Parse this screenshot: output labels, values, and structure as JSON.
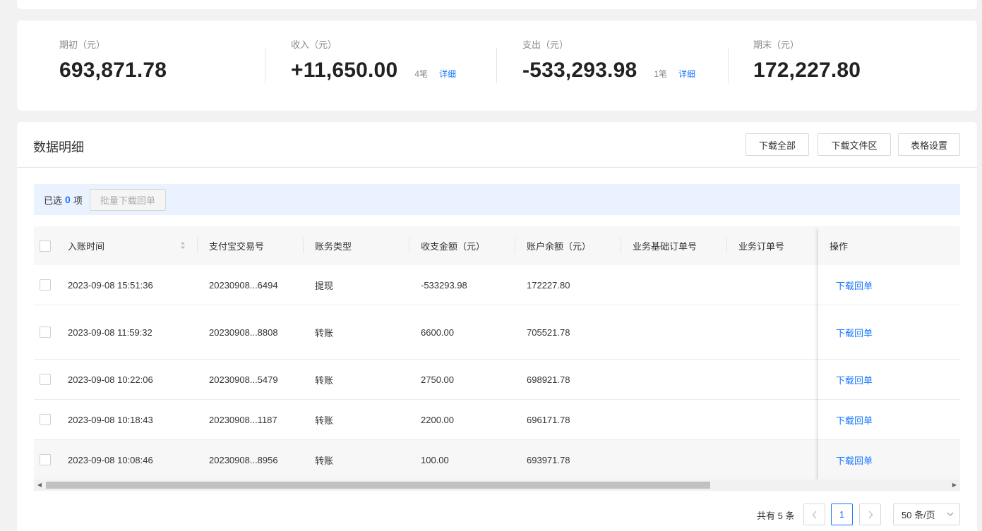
{
  "summary": {
    "opening": {
      "label": "期初（元）",
      "value": "693,871.78"
    },
    "income": {
      "label": "收入（元）",
      "value": "+11,650.00",
      "count": "4笔",
      "detail": "详细"
    },
    "expense": {
      "label": "支出（元）",
      "value": "-533,293.98",
      "count": "1笔",
      "detail": "详细"
    },
    "closing": {
      "label": "期末（元）",
      "value": "172,227.80"
    }
  },
  "detail": {
    "title": "数据明细",
    "buttons": {
      "download_all": "下载全部",
      "download_files": "下载文件区",
      "table_settings": "表格设置"
    }
  },
  "selection": {
    "prefix": "已选",
    "count": "0",
    "suffix": "项",
    "batch_button": "批量下载回单"
  },
  "table": {
    "columns": [
      "入账时间",
      "支付宝交易号",
      "账务类型",
      "收支金额（元）",
      "账户余额（元）",
      "业务基础订单号",
      "业务订单号",
      "操作"
    ],
    "rows": [
      {
        "time": "2023-09-08 15:51:36",
        "trade_no": "20230908...6494",
        "type": "提现",
        "amount": "-533293.98",
        "balance": "172227.80",
        "action": "下载回单"
      },
      {
        "time": "2023-09-08 11:59:32",
        "trade_no": "20230908...8808",
        "type": "转账",
        "amount": "6600.00",
        "balance": "705521.78",
        "action": "下载回单"
      },
      {
        "time": "2023-09-08 10:22:06",
        "trade_no": "20230908...5479",
        "type": "转账",
        "amount": "2750.00",
        "balance": "698921.78",
        "action": "下载回单"
      },
      {
        "time": "2023-09-08 10:18:43",
        "trade_no": "20230908...1187",
        "type": "转账",
        "amount": "2200.00",
        "balance": "696171.78",
        "action": "下载回单"
      },
      {
        "time": "2023-09-08 10:08:46",
        "trade_no": "20230908...8956",
        "type": "转账",
        "amount": "100.00",
        "balance": "693971.78",
        "action": "下载回单"
      }
    ]
  },
  "pagination": {
    "total": "共有 5 条",
    "current_page": "1",
    "page_size": "50 条/页"
  },
  "icons": {
    "sort": "sort-icon",
    "prev": "chevron-left-icon",
    "next": "chevron-right-icon",
    "dropdown": "chevron-down-icon"
  },
  "colors": {
    "accent": "#1677ff",
    "selection_bar": "#eaf2ff",
    "page_bg": "#f2f2f2"
  }
}
